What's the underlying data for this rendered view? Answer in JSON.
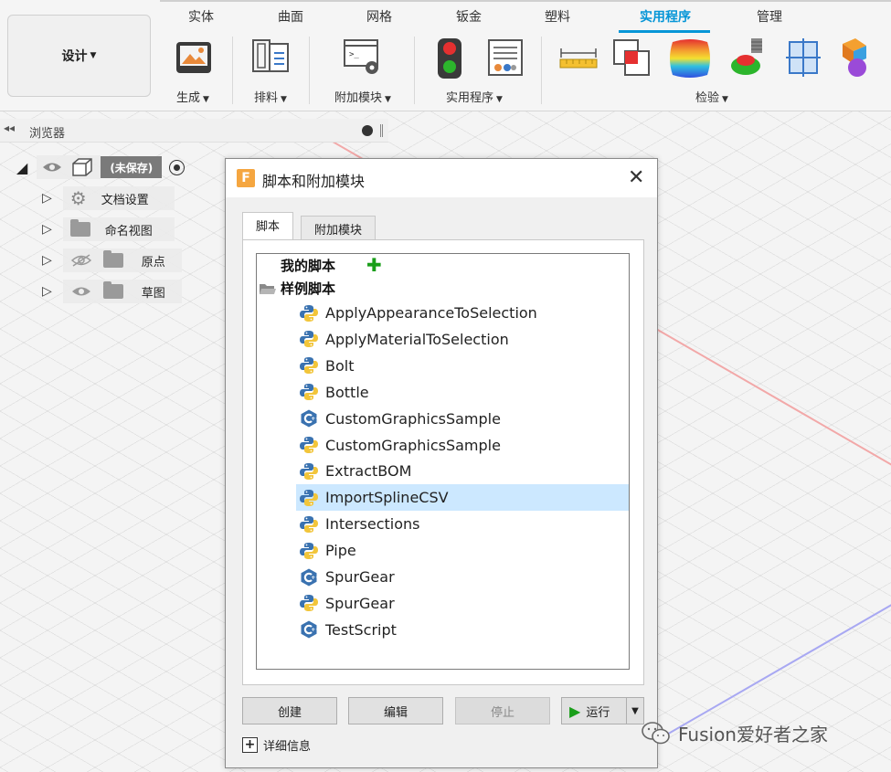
{
  "ribbon": {
    "design_label": "设计",
    "tabs": [
      "实体",
      "曲面",
      "网格",
      "钣金",
      "塑料",
      "实用程序",
      "管理"
    ],
    "active_tab": "实用程序",
    "groups": {
      "create": "生成",
      "arrange": "排料",
      "addins": "附加模块",
      "utilities": "实用程序",
      "inspect": "检验"
    }
  },
  "browser": {
    "title": "浏览器",
    "root": "(未保存)",
    "nodes": [
      "文档设置",
      "命名视图",
      "原点",
      "草图"
    ]
  },
  "dialog": {
    "title": "脚本和附加模块",
    "tabs": [
      "脚本",
      "附加模块"
    ],
    "my_scripts": "我的脚本",
    "sample_scripts": "样例脚本",
    "items": [
      {
        "name": "ApplyAppearanceToSelection",
        "lang": "python-icon"
      },
      {
        "name": "ApplyMaterialToSelection",
        "lang": "python-icon"
      },
      {
        "name": "Bolt",
        "lang": "python-icon"
      },
      {
        "name": "Bottle",
        "lang": "python-icon"
      },
      {
        "name": "CustomGraphicsSample",
        "lang": "cpp-icon"
      },
      {
        "name": "CustomGraphicsSample",
        "lang": "python-icon"
      },
      {
        "name": "ExtractBOM",
        "lang": "python-icon"
      },
      {
        "name": "ImportSplineCSV",
        "lang": "python-icon"
      },
      {
        "name": "Intersections",
        "lang": "python-icon"
      },
      {
        "name": "Pipe",
        "lang": "python-icon"
      },
      {
        "name": "SpurGear",
        "lang": "cpp-icon"
      },
      {
        "name": "SpurGear",
        "lang": "python-icon"
      },
      {
        "name": "TestScript",
        "lang": "cpp-icon"
      }
    ],
    "selected_item": "ImportSplineCSV",
    "buttons": {
      "create": "创建",
      "edit": "编辑",
      "stop": "停止",
      "run": "运行"
    },
    "details": "详细信息"
  },
  "watermark": "Fusion爱好者之家",
  "colors": {
    "accent": "#0696d7",
    "selection": "#cce8ff",
    "run_green": "#1a9e1a"
  }
}
